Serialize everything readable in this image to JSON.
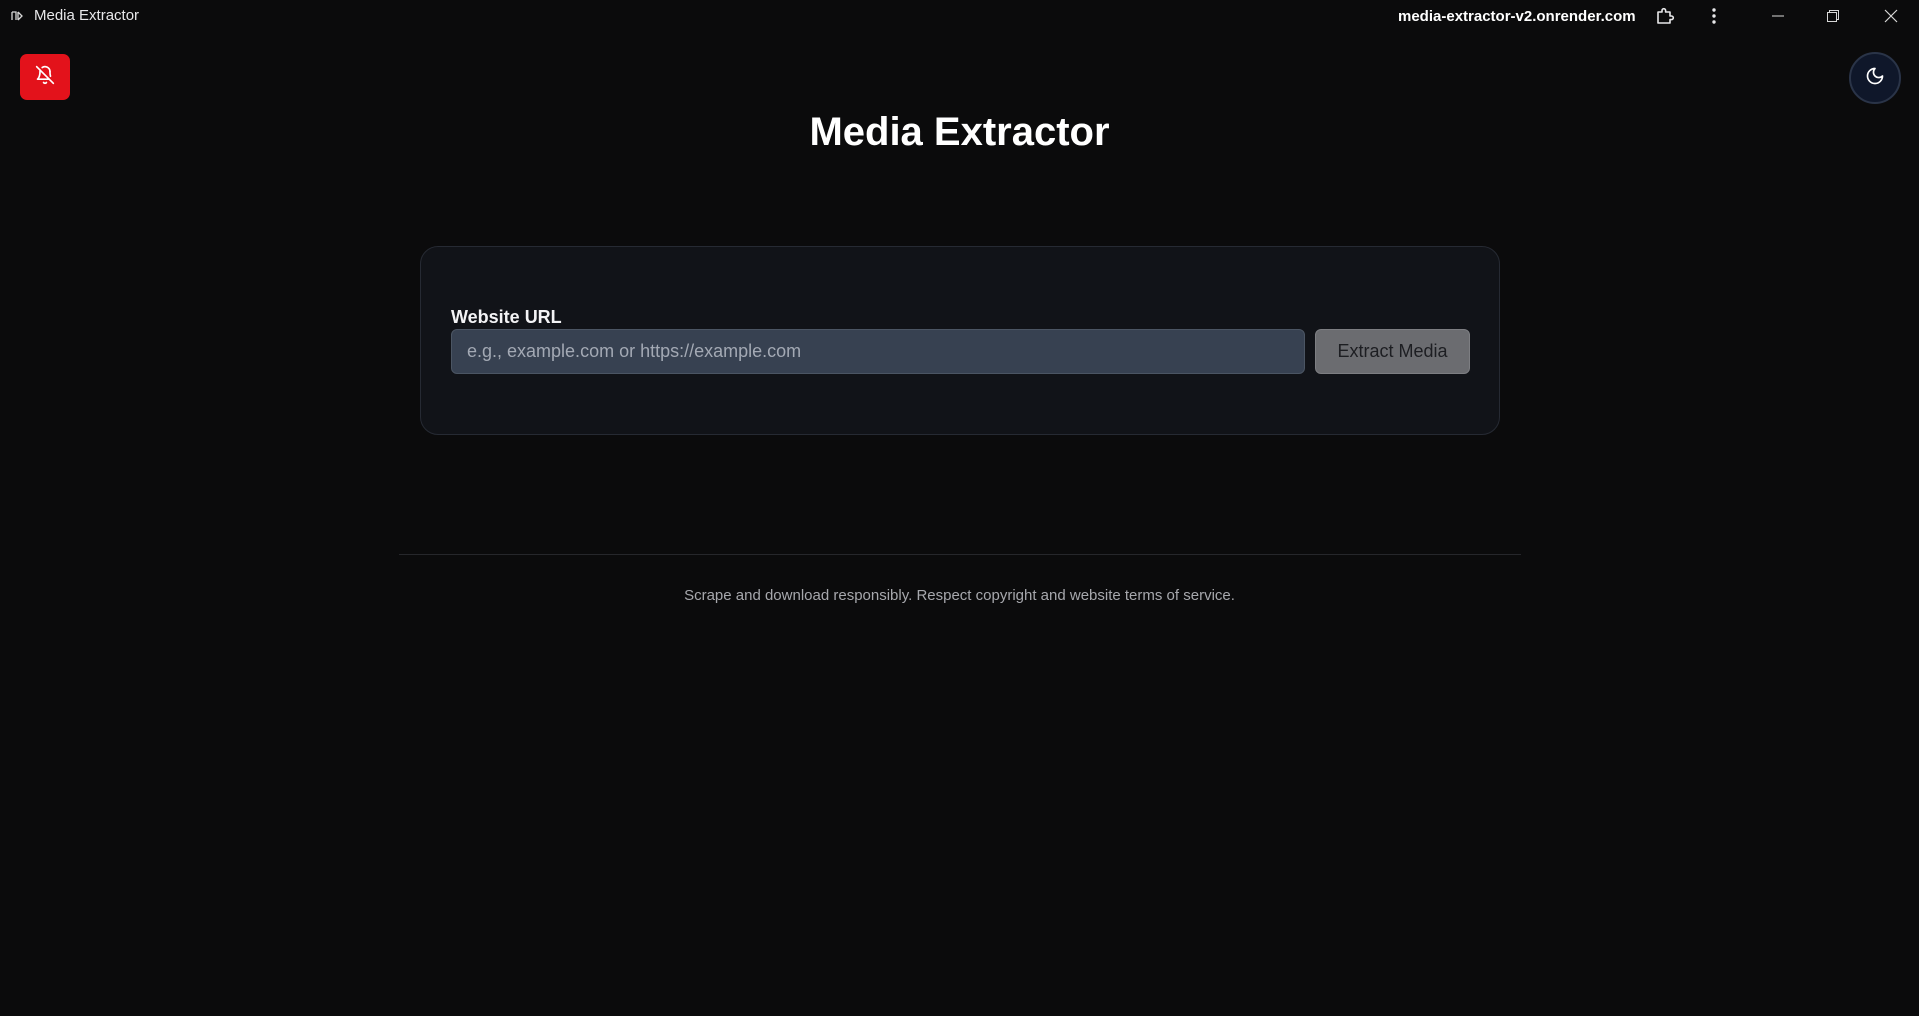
{
  "window": {
    "app_title": "Media Extractor",
    "app_icon": "media-extractor-logo-icon",
    "url": "media-extractor-v2.onrender.com",
    "icons": [
      "extensions-icon",
      "more-vert-icon",
      "minimize-icon",
      "restore-icon",
      "close-icon"
    ]
  },
  "header": {
    "notifications_icon": "bell-off-icon",
    "notifications_color": "#e3121b",
    "theme_icon": "moon-icon",
    "title": "Media Extractor"
  },
  "form": {
    "label": "Website URL",
    "input_value": "",
    "input_placeholder": "e.g., example.com or https://example.com",
    "submit_label": "Extract Media"
  },
  "footer": {
    "text": "Scrape and download responsibly. Respect copyright and website terms of service."
  }
}
